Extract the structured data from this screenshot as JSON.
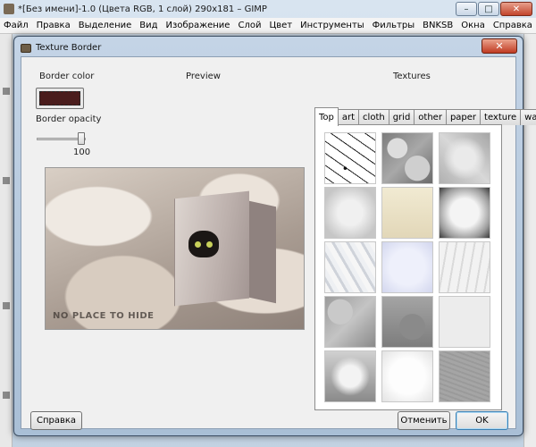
{
  "gimp": {
    "title": "*[Без имени]-1.0 (Цвета RGB, 1 слой) 290x181 – GIMP",
    "window_buttons": [
      "–",
      "□",
      "✕"
    ],
    "menu": [
      {
        "label": "Файл"
      },
      {
        "label": "Правка"
      },
      {
        "label": "Выделение"
      },
      {
        "label": "Вид"
      },
      {
        "label": "Изображение"
      },
      {
        "label": "Слой"
      },
      {
        "label": "Цвет"
      },
      {
        "label": "Инструменты"
      },
      {
        "label": "Фильтры"
      },
      {
        "label": "BNKSB"
      },
      {
        "label": "Окна"
      },
      {
        "label": "Справка"
      }
    ]
  },
  "dialog": {
    "title": "Texture Border",
    "close_glyph": "✕",
    "border_color_label": "Border color",
    "border_color_value": "#4a1c1c",
    "border_opacity_label": "Border opacity",
    "border_opacity_value": "100",
    "preview_label": "Preview",
    "preview_caption": "NO PLACE TO HIDE",
    "textures_label": "Textures",
    "tabs": [
      {
        "label": "Top",
        "active": true
      },
      {
        "label": "art",
        "active": false
      },
      {
        "label": "cloth",
        "active": false
      },
      {
        "label": "grid",
        "active": false
      },
      {
        "label": "other",
        "active": false
      },
      {
        "label": "paper",
        "active": false
      },
      {
        "label": "texture",
        "active": false
      },
      {
        "label": "wall",
        "active": false
      }
    ],
    "thumbnail_count": 15,
    "help_button": "Справка",
    "cancel_button": "Отменить",
    "ok_button": "OK"
  }
}
